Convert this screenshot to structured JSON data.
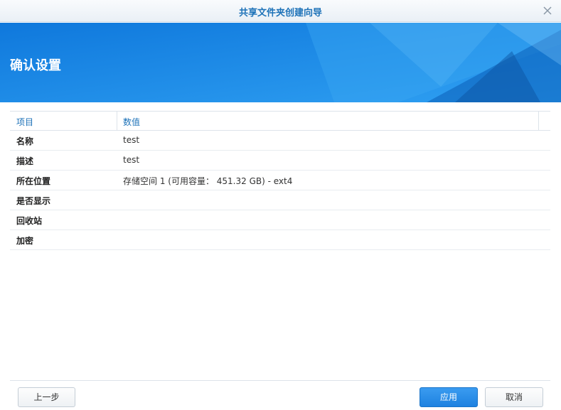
{
  "window": {
    "title": "共享文件夹创建向导",
    "close_icon": "close-icon"
  },
  "banner": {
    "heading": "确认设置",
    "accent": "#1a86e6"
  },
  "table": {
    "headers": [
      "项目",
      "数值"
    ],
    "rows": [
      {
        "key": "名称",
        "value": "test"
      },
      {
        "key": "描述",
        "value": "test"
      },
      {
        "key": "所在位置",
        "value": "存储空间 1 (可用容量： 451.32 GB) - ext4"
      },
      {
        "key": "是否显示",
        "value": ""
      },
      {
        "key": "回收站",
        "value": ""
      },
      {
        "key": "加密",
        "value": ""
      }
    ]
  },
  "buttons": {
    "prev": "上一步",
    "apply": "应用",
    "cancel": "取消"
  },
  "colors": {
    "title": "#1d72b8",
    "primary": "#1e82e0"
  }
}
